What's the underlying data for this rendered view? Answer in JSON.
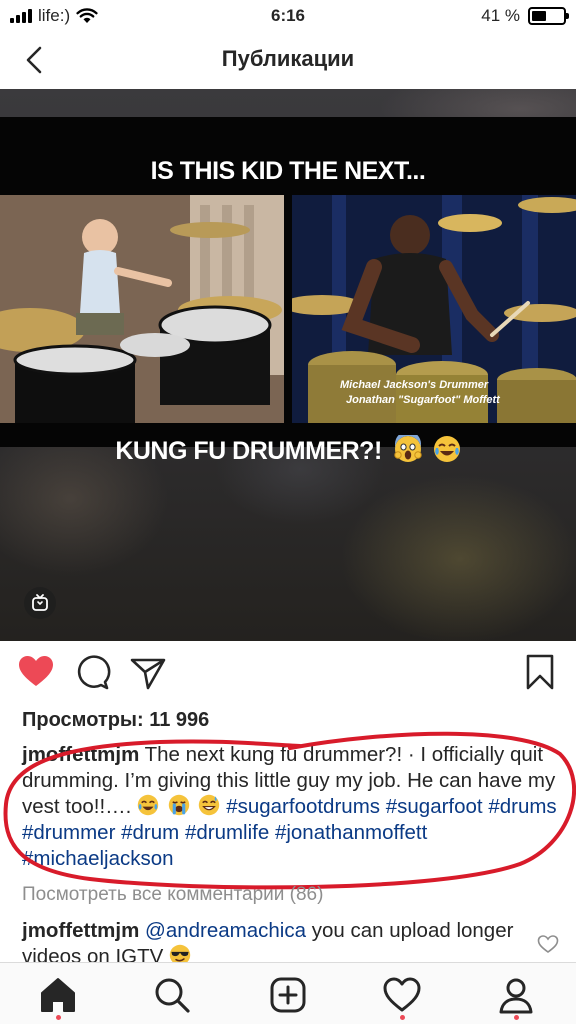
{
  "status_bar": {
    "carrier": "life:)",
    "time": "6:16",
    "battery_text": "41 %",
    "battery_level": 0.41
  },
  "header": {
    "title": "Публикации",
    "back_icon": "chevron-left-icon"
  },
  "video": {
    "headline": "IS THIS KID THE NEXT...",
    "subtitle": "KUNG FU DRUMMER?!",
    "subtitle_emoji": [
      "face-screaming-icon",
      "face-tears-of-joy-icon"
    ],
    "caption_line1": "Michael Jackson's Drummer",
    "caption_line2": "Jonathan \"Sugarfoot\" Moffett",
    "badge_icon": "igtv-icon"
  },
  "actions": {
    "like_icon": "heart-filled-icon",
    "comment_icon": "comment-icon",
    "share_icon": "share-icon",
    "save_icon": "bookmark-icon"
  },
  "post": {
    "views": "Просмотры: 11 996",
    "caption_user": "jmoffettmjm",
    "caption_text": " The next kung fu drummer?! · I officially quit drumming. I’m giving this little guy my job. He can have my vest too!!…. ",
    "caption_emoji": [
      "face-tears-of-joy-icon",
      "loudly-crying-face-icon",
      "grinning-sweat-face-icon"
    ],
    "hashtags": [
      "#sugarfootdrums",
      "#sugarfoot",
      "#drums",
      "#drummer",
      "#drum",
      "#drumlife",
      "#jonathanmoffett",
      "#michaeljackson"
    ],
    "view_comments": "Посмотреть все комментарии (86)",
    "comment": {
      "user": "jmoffettmjm",
      "mention": "@andreamachica",
      "text": " you can upload longer videos on IGTV ",
      "emoji": "sunglasses-face-icon"
    }
  },
  "colors": {
    "like": "#ed4956",
    "link": "#0b3a85",
    "annotation": "#d81b2a",
    "muted": "#8e8e8e"
  },
  "tabbar": {
    "items": [
      "home-icon",
      "search-icon",
      "new-post-icon",
      "activity-heart-icon",
      "profile-icon"
    ]
  }
}
